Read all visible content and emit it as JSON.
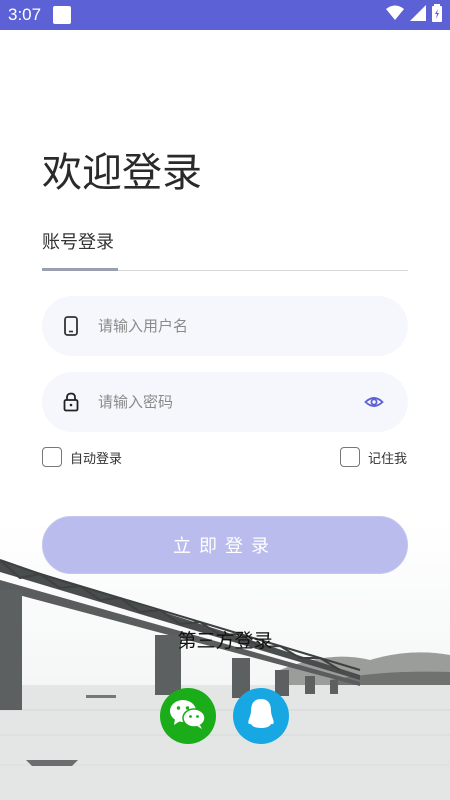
{
  "status_bar": {
    "time": "3:07"
  },
  "login": {
    "title": "欢迎登录",
    "tab_label": "账号登录",
    "username_placeholder": "请输入用户名",
    "password_placeholder": "请输入密码",
    "auto_login_label": "自动登录",
    "remember_label": "记住我",
    "login_button": "立即登录",
    "third_party_label": "第三方登录"
  },
  "colors": {
    "status_bar": "#5c62d6",
    "accent": "#5c62d6",
    "button_disabled": "#b9bced",
    "wechat": "#1aad19",
    "qq": "#17a8e3"
  }
}
